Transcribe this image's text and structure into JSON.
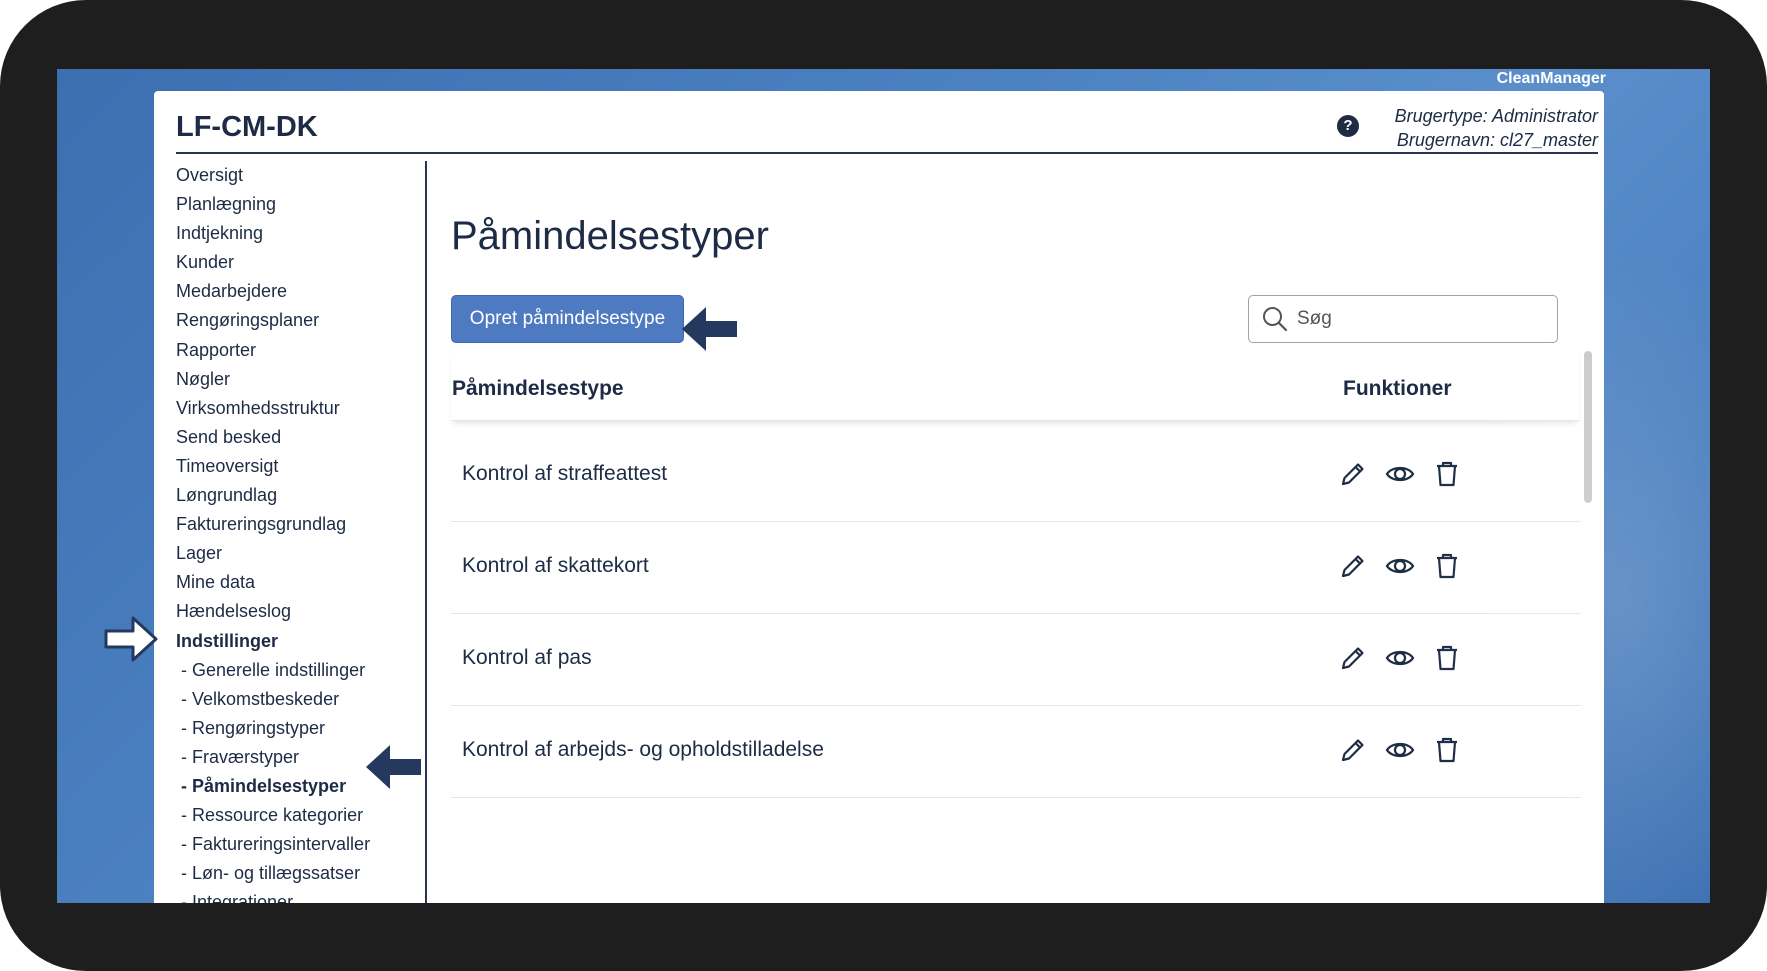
{
  "brand": "CleanManager",
  "app": {
    "title": "LF-CM-DK",
    "user_type": "Brugertype: Administrator",
    "user_name": "Brugernavn: cl27_master",
    "help_icon": "question-circle-icon"
  },
  "sidebar": {
    "items": [
      {
        "label": "Oversigt"
      },
      {
        "label": "Planlægning"
      },
      {
        "label": "Indtjekning"
      },
      {
        "label": "Kunder"
      },
      {
        "label": "Medarbejdere"
      },
      {
        "label": "Rengøringsplaner"
      },
      {
        "label": "Rapporter"
      },
      {
        "label": "Nøgler"
      },
      {
        "label": "Virksomhedsstruktur"
      },
      {
        "label": "Send besked"
      },
      {
        "label": "Timeoversigt"
      },
      {
        "label": "Løngrundlag"
      },
      {
        "label": "Faktureringsgrundlag"
      },
      {
        "label": "Lager"
      },
      {
        "label": "Mine data"
      },
      {
        "label": "Hændelseslog"
      },
      {
        "label": "Indstillinger"
      }
    ],
    "subitems": [
      {
        "label": "- Generelle indstillinger"
      },
      {
        "label": "- Velkomstbeskeder"
      },
      {
        "label": "- Rengøringstyper"
      },
      {
        "label": "- Fraværstyper"
      },
      {
        "label": "- Påmindelsestyper"
      },
      {
        "label": "- Ressource kategorier"
      },
      {
        "label": "- Faktureringsintervaller"
      },
      {
        "label": "- Løn- og tillægssatser"
      },
      {
        "label": "- Integrationer"
      }
    ],
    "active_item": "Indstillinger",
    "active_subitem": "- Påmindelsestyper"
  },
  "main": {
    "title": "Påmindelsestyper",
    "create_button": "Opret påmindelsestype",
    "search": {
      "placeholder": "Søg",
      "value": ""
    },
    "table": {
      "columns": [
        "Påmindelsestype",
        "Funktioner"
      ],
      "rows": [
        {
          "name": "Kontrol af straffeattest"
        },
        {
          "name": "Kontrol af skattekort"
        },
        {
          "name": "Kontrol af pas"
        },
        {
          "name": "Kontrol af arbejds- og opholdstilladelse"
        }
      ],
      "actions": [
        "edit-pencil-icon",
        "view-eye-icon",
        "delete-trash-icon"
      ]
    }
  },
  "colors": {
    "accent": "#4e7ac2",
    "text": "#1d2b45",
    "arrow": "#25395e",
    "desktop": "#4a7fc0",
    "frame": "#1e1e1e"
  }
}
